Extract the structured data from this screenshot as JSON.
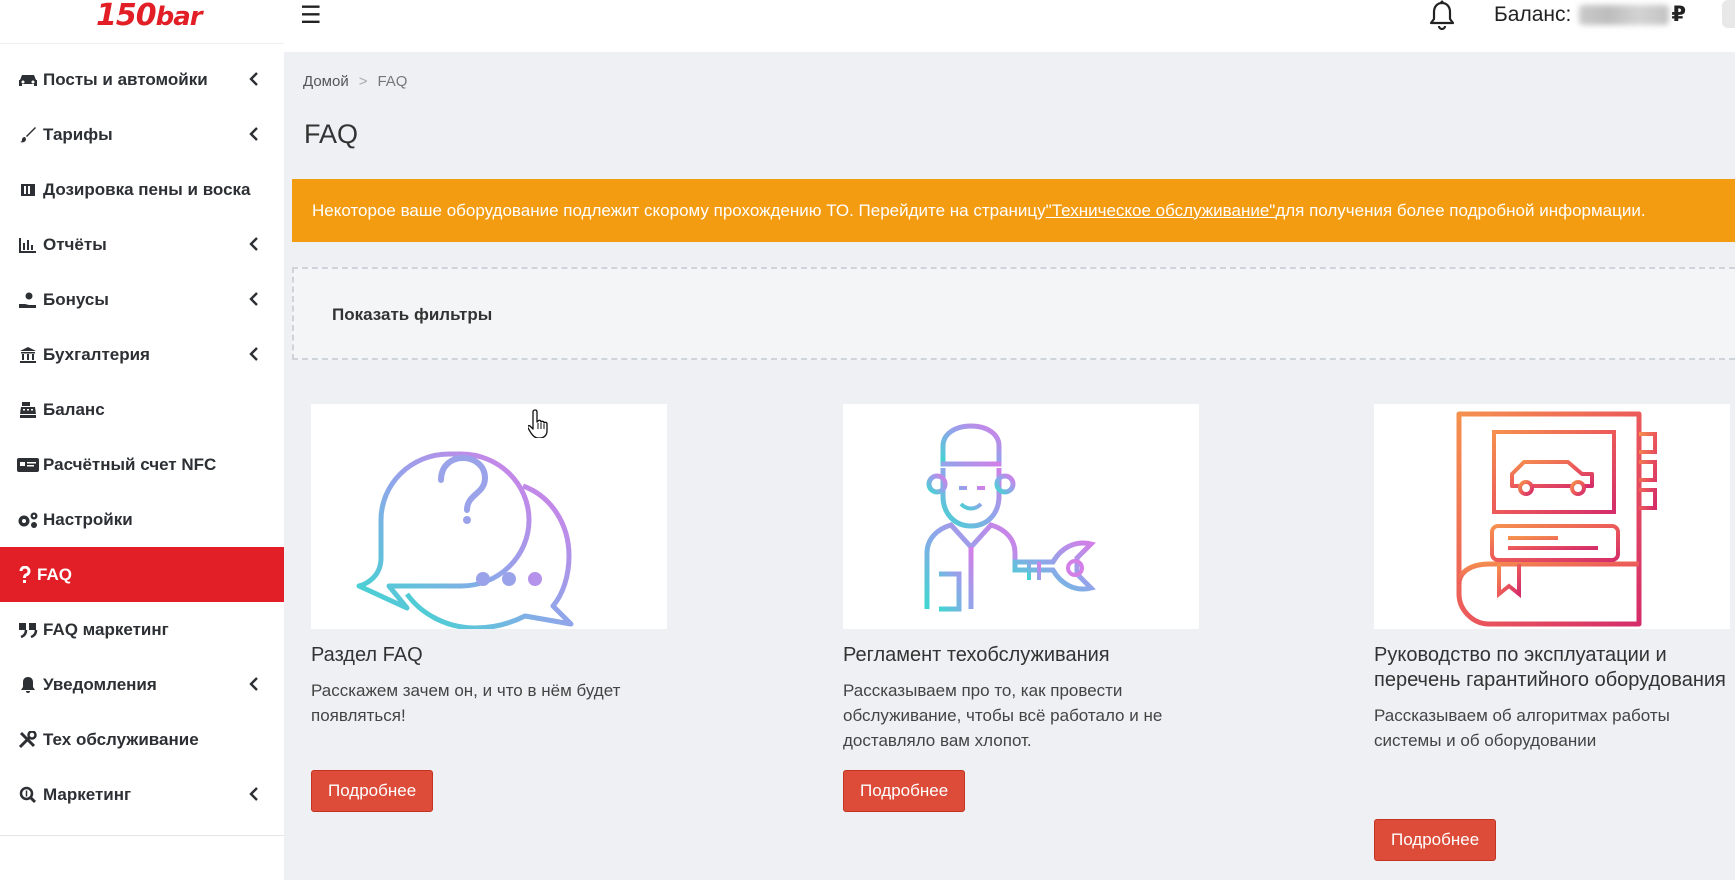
{
  "header": {
    "logo_num": "150",
    "logo_text": "bar",
    "menu_icon": "☰",
    "balance_label": "Баланс:",
    "currency": "₽"
  },
  "sidebar": {
    "items": [
      {
        "label": "Посты и автомойки",
        "icon": "car-icon",
        "has_submenu": true
      },
      {
        "label": "Тарифы",
        "icon": "brush-icon",
        "has_submenu": true
      },
      {
        "label": "Дозировка пены и воска",
        "icon": "dosing-icon",
        "has_submenu": false
      },
      {
        "label": "Отчёты",
        "icon": "bar-chart-icon",
        "has_submenu": true
      },
      {
        "label": "Бонусы",
        "icon": "hand-coin-icon",
        "has_submenu": true
      },
      {
        "label": "Бухгалтерия",
        "icon": "bank-icon",
        "has_submenu": true
      },
      {
        "label": "Баланс",
        "icon": "cash-register-icon",
        "has_submenu": false
      },
      {
        "label": "Расчётный счет NFC",
        "icon": "card-icon",
        "has_submenu": false
      },
      {
        "label": "Настройки",
        "icon": "gears-icon",
        "has_submenu": false
      },
      {
        "label": "FAQ",
        "icon": "question-icon",
        "has_submenu": false,
        "active": true
      },
      {
        "label": "FAQ маркетинг",
        "icon": "quote-icon",
        "has_submenu": false
      },
      {
        "label": "Уведомления",
        "icon": "bell-icon",
        "has_submenu": true
      },
      {
        "label": "Тех обслуживание",
        "icon": "tools-icon",
        "has_submenu": false
      },
      {
        "label": "Маркетинг",
        "icon": "search-dollar-icon",
        "has_submenu": true
      }
    ]
  },
  "breadcrumb": {
    "home": "Домой",
    "separator": ">",
    "current": "FAQ"
  },
  "page": {
    "title": "FAQ"
  },
  "alert": {
    "text_before": "Некоторое ваше оборудование подлежит скорому прохождению ТО. Перейдите на страницу ",
    "link": "\"Техническое обслуживание\"",
    "text_after": " для получения более подробной информации.",
    "color": "#f39c12"
  },
  "filters": {
    "label": "Показать фильтры"
  },
  "cards": [
    {
      "title": "Раздел FAQ",
      "description": "Расскажем зачем он, и что в нём будет появляться!",
      "button": "Подробнее",
      "icon": "faq-chat-icon"
    },
    {
      "title": "Регламент техобслуживания",
      "description": "Рассказываем про то, как провести обслуживание, чтобы всё работало и не доставляло вам хлопот.",
      "button": "Подробнее",
      "icon": "mechanic-icon"
    },
    {
      "title": "Руководство по эксплуатации и перечень гарантийного оборудования",
      "description": "Рассказываем об алгоритмах работы системы и об оборудовании",
      "button": "Подробнее",
      "icon": "manual-book-icon"
    }
  ],
  "colors": {
    "brand": "#e21f26",
    "button": "#dd4b39",
    "alert": "#f39c12"
  }
}
